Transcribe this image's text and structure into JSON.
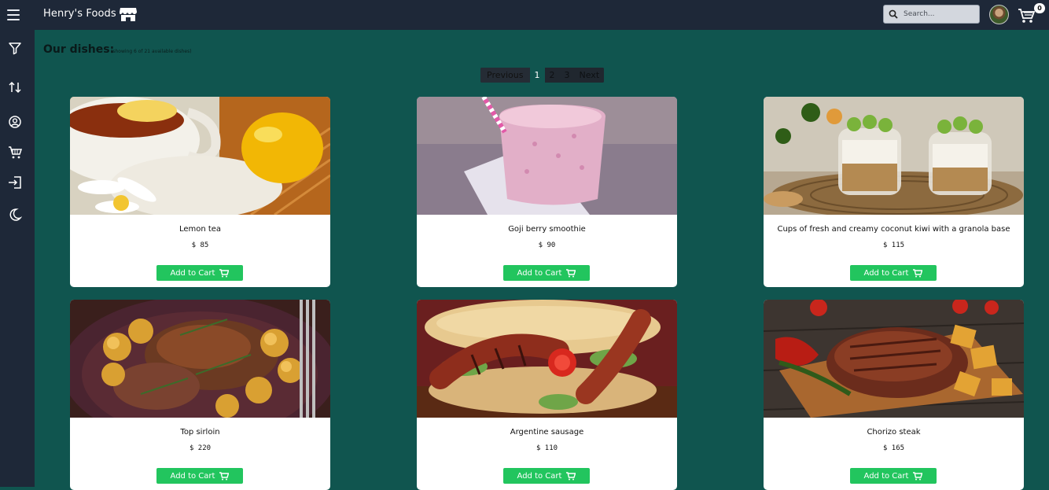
{
  "app": {
    "brand": "Henry's Foods",
    "search_placeholder": "Search...",
    "cart_count": "0"
  },
  "sidebar": {
    "items": [
      "menu-icon",
      "filter-icon",
      "sort-icon",
      "user-icon",
      "cart-icon",
      "logout-icon",
      "dark-mode-icon"
    ]
  },
  "main": {
    "heading": "Our dishes:",
    "subnote": "(showing 6 of 21 available dishes)",
    "pager": {
      "prev": "Previous",
      "pages": [
        "1",
        "2",
        "3"
      ],
      "next": "Next",
      "current": "1"
    }
  },
  "dishes": [
    {
      "title": "Lemon tea",
      "price": "$ 85",
      "button": "Add to Cart",
      "image": "lemon-tea-photo"
    },
    {
      "title": "Goji berry smoothie",
      "price": "$ 90",
      "button": "Add to Cart",
      "image": "smoothie-photo"
    },
    {
      "title": "Cups of fresh and creamy coconut kiwi with a granola base",
      "price": "$ 115",
      "button": "Add to Cart",
      "image": "kiwi-granola-photo"
    },
    {
      "title": "Top sirloin",
      "price": "$ 220",
      "button": "Add to Cart",
      "image": "sirloin-photo"
    },
    {
      "title": "Argentine sausage",
      "price": "$ 110",
      "button": "Add to Cart",
      "image": "sausage-photo"
    },
    {
      "title": "Chorizo steak",
      "price": "$ 165",
      "button": "Add to Cart",
      "image": "steak-photo"
    }
  ],
  "colors": {
    "topbar": "#1e2838",
    "background": "#10554f",
    "button": "#22c55e"
  }
}
